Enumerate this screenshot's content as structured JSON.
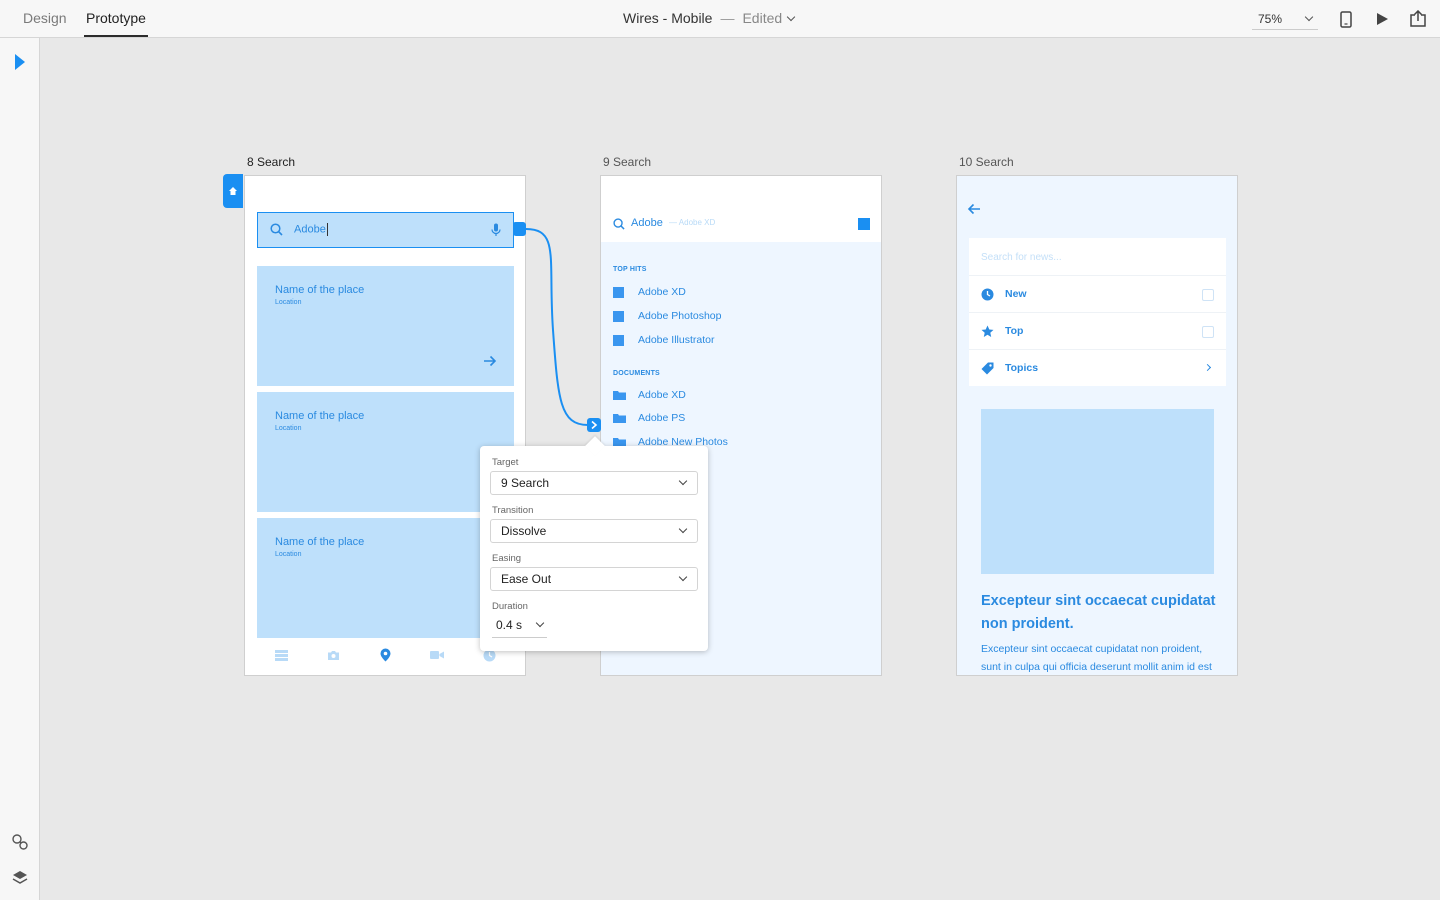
{
  "topbar": {
    "tabs": [
      {
        "label": "Design"
      },
      {
        "label": "Prototype"
      }
    ],
    "document_title": "Wires - Mobile",
    "separator": "—",
    "status": "Edited",
    "zoom": "75%"
  },
  "artboards": {
    "a1": {
      "label": "8 Search",
      "search_value": "Adobe",
      "cards": [
        {
          "title": "Name of the place",
          "location": "Location"
        },
        {
          "title": "Name of the place",
          "location": "Location"
        },
        {
          "title": "Name of the place",
          "location": "Location"
        }
      ]
    },
    "a2": {
      "label": "9 Search",
      "query": "Adobe",
      "hint": "— Adobe XD",
      "top_hits_title": "TOP HITS",
      "top_hits": [
        "Adobe XD",
        "Adobe Photoshop",
        "Adobe Illustrator"
      ],
      "documents_title": "DOCUMENTS",
      "documents": [
        "Adobe XD",
        "Adobe PS",
        "Adobe New Photos"
      ]
    },
    "a3": {
      "label": "10 Search",
      "search_placeholder": "Search for news...",
      "filters": [
        {
          "label": "New",
          "icon": "clock-icon"
        },
        {
          "label": "Top",
          "icon": "star-icon"
        },
        {
          "label": "Topics",
          "icon": "tag-icon"
        }
      ],
      "headline": "Excepteur sint occaecat cupidatat non proident.",
      "body": "Excepteur sint occaecat cupidatat non proident, sunt in culpa qui officia deserunt mollit anim id est"
    }
  },
  "interaction": {
    "target_label": "Target",
    "target_value": "9 Search",
    "transition_label": "Transition",
    "transition_value": "Dissolve",
    "easing_label": "Easing",
    "easing_value": "Ease Out",
    "duration_label": "Duration",
    "duration_value": "0.4 s"
  },
  "colors": {
    "accent": "#1a8ff2",
    "wire_fill": "#bee0fb",
    "wire_text": "#2a8ae0"
  }
}
